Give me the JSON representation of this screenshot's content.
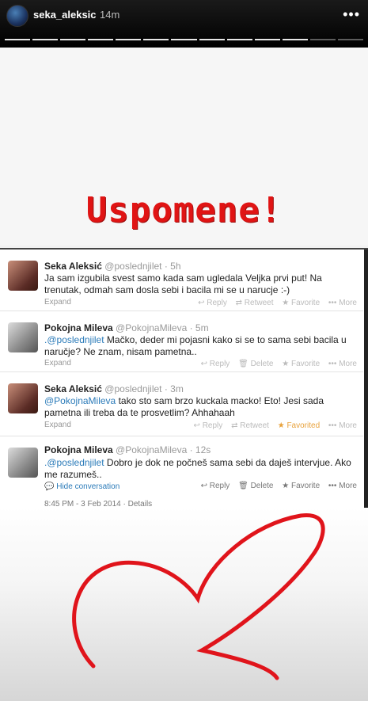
{
  "header": {
    "username": "seka_aleksic",
    "time": "14m",
    "more_icon": "more-dots-icon",
    "progress_segments": 13,
    "progress_viewed": 11
  },
  "title": "Uspomene!",
  "tweets": [
    {
      "name": "Seka Aleksić",
      "handle": "@poslednjilet · 5h",
      "text": "Ja sam izgubila svest samo kada sam ugledala Veljka prvi put! Na trenutak, odmah sam dosla sebi i bacila mi se u narucje :-)",
      "expand": "Expand",
      "actions": [
        "Reply",
        "Retweet",
        "Favorite",
        "••• More"
      ]
    },
    {
      "name": "Pokojna Mileva",
      "handle": "@PokojnaMileva · 5m",
      "mention": ".@poslednjilet",
      "text": " Mačko, deder mi pojasni kako si se to sama sebi bacila u naručje? Ne znam, nisam pametna..",
      "expand": "Expand",
      "actions": [
        "Reply",
        "Delete",
        "Favorite",
        "••• More"
      ]
    },
    {
      "name": "Seka Aleksić",
      "handle": "@poslednjilet · 3m",
      "mention": "@PokojnaMileva",
      "text": " tako sto sam brzo kuckala macko! Eto! Jesi sada pametna ili treba da te prosvetlim? Ahhahaah",
      "expand": "Expand",
      "actions": [
        "Reply",
        "Retweet",
        "Favorited",
        "••• More"
      ]
    },
    {
      "name": "Pokojna Mileva",
      "handle": "@PokojnaMileva · 12s",
      "mention": ".@poslednjilet",
      "text": " Dobro je dok ne počneš sama sebi da daješ intervjue. Ako me razumeš..",
      "hide": "Hide conversation",
      "actions": [
        "Reply",
        "Delete",
        "Favorite",
        "••• More"
      ],
      "date": "8:45 PM - 3 Feb 2014 · Details"
    }
  ],
  "colors": {
    "title_red": "#e01414",
    "heart_red": "#e0141b",
    "link_blue": "#2b7bb9",
    "favorited": "#e8a23c"
  }
}
